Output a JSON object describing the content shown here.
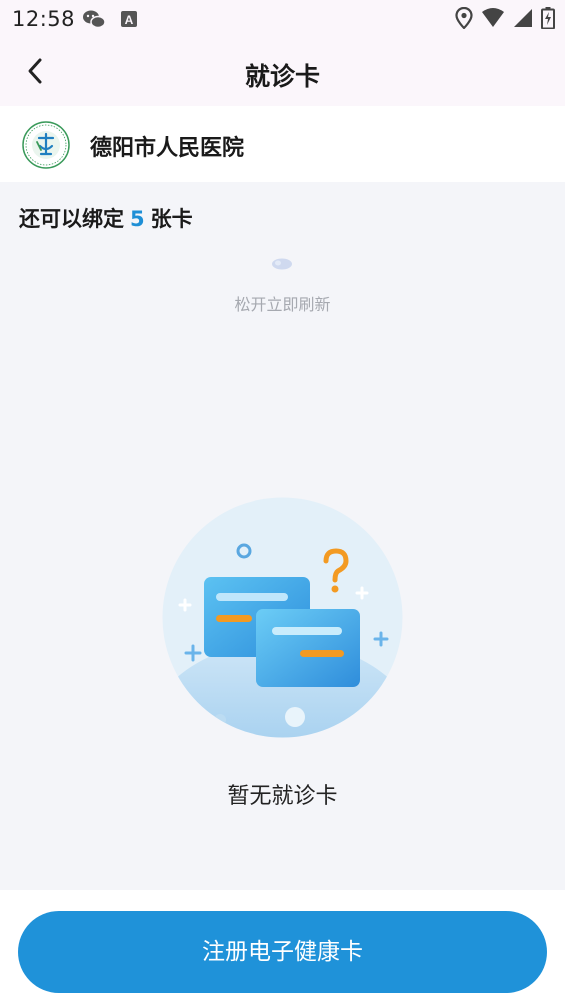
{
  "status_bar": {
    "time": "12:58",
    "left_icons": [
      "wechat-icon",
      "font-a-icon"
    ],
    "right_icons": [
      "location-icon",
      "wifi-icon",
      "signal-icon",
      "battery-charging-icon"
    ]
  },
  "header": {
    "title": "就诊卡",
    "back_icon": "chevron-left-icon"
  },
  "hospital": {
    "name": "德阳市人民医院",
    "logo_icon": "hospital-logo-icon"
  },
  "bind_info": {
    "prefix": "还可以绑定",
    "count": "5",
    "suffix": "张卡"
  },
  "refresh": {
    "text": "松开立即刷新"
  },
  "empty_state": {
    "text": "暂无就诊卡",
    "illustration": "empty-cards-illustration"
  },
  "bottom": {
    "register_label": "注册电子健康卡"
  },
  "colors": {
    "accent": "#1f92d9",
    "count": "#1e8fd6",
    "header_bg": "#fbf6fb",
    "page_bg": "#f4f5f9"
  }
}
